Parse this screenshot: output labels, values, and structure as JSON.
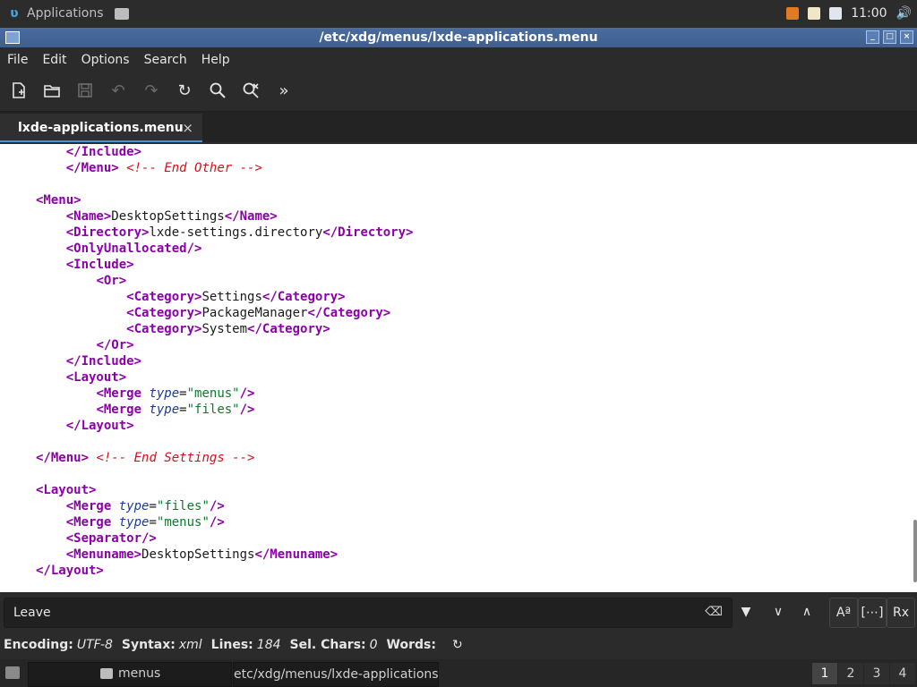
{
  "top_panel": {
    "applications_label": "Applications",
    "clock": "11:00"
  },
  "window": {
    "title": "/etc/xdg/menus/lxde-applications.menu",
    "buttons": {
      "minimize": "_",
      "maximize": "□",
      "close": "×"
    }
  },
  "menubar": {
    "items": [
      "File",
      "Edit",
      "Options",
      "Search",
      "Help"
    ]
  },
  "tabs": [
    {
      "label": "lxde-applications.menu",
      "close": "×"
    }
  ],
  "editor": {
    "lines": [
      [
        {
          "t": "    "
        },
        {
          "c": "tag",
          "t": "</Include>"
        }
      ],
      [
        {
          "t": "    "
        },
        {
          "c": "tag",
          "t": "</Menu>"
        },
        {
          "t": " "
        },
        {
          "c": "com",
          "t": "<!-- End Other -->"
        }
      ],
      [],
      [
        {
          "c": "tag",
          "t": "<Menu>"
        }
      ],
      [
        {
          "t": "    "
        },
        {
          "c": "tag",
          "t": "<Name>"
        },
        {
          "t": "DesktopSettings"
        },
        {
          "c": "tag",
          "t": "</Name>"
        }
      ],
      [
        {
          "t": "    "
        },
        {
          "c": "tag",
          "t": "<Directory>"
        },
        {
          "t": "lxde-settings.directory"
        },
        {
          "c": "tag",
          "t": "</Directory>"
        }
      ],
      [
        {
          "t": "    "
        },
        {
          "c": "tag",
          "t": "<OnlyUnallocated/>"
        }
      ],
      [
        {
          "t": "    "
        },
        {
          "c": "tag",
          "t": "<Include>"
        }
      ],
      [
        {
          "t": "        "
        },
        {
          "c": "tag",
          "t": "<Or>"
        }
      ],
      [
        {
          "t": "            "
        },
        {
          "c": "tag",
          "t": "<Category>"
        },
        {
          "t": "Settings"
        },
        {
          "c": "tag",
          "t": "</Category>"
        }
      ],
      [
        {
          "t": "            "
        },
        {
          "c": "tag",
          "t": "<Category>"
        },
        {
          "t": "PackageManager"
        },
        {
          "c": "tag",
          "t": "</Category>"
        }
      ],
      [
        {
          "t": "            "
        },
        {
          "c": "tag",
          "t": "<Category>"
        },
        {
          "t": "System"
        },
        {
          "c": "tag",
          "t": "</Category>"
        }
      ],
      [
        {
          "t": "        "
        },
        {
          "c": "tag",
          "t": "</Or>"
        }
      ],
      [
        {
          "t": "    "
        },
        {
          "c": "tag",
          "t": "</Include>"
        }
      ],
      [
        {
          "t": "    "
        },
        {
          "c": "tag",
          "t": "<Layout>"
        }
      ],
      [
        {
          "t": "        "
        },
        {
          "c": "tag",
          "t": "<Merge "
        },
        {
          "c": "attr",
          "t": "type"
        },
        {
          "t": "="
        },
        {
          "c": "str",
          "t": "\"menus\""
        },
        {
          "c": "tag",
          "t": "/>"
        }
      ],
      [
        {
          "t": "        "
        },
        {
          "c": "tag",
          "t": "<Merge "
        },
        {
          "c": "attr",
          "t": "type"
        },
        {
          "t": "="
        },
        {
          "c": "str",
          "t": "\"files\""
        },
        {
          "c": "tag",
          "t": "/>"
        }
      ],
      [
        {
          "t": "    "
        },
        {
          "c": "tag",
          "t": "</Layout>"
        }
      ],
      [],
      [
        {
          "c": "tag",
          "t": "</Menu>"
        },
        {
          "t": " "
        },
        {
          "c": "com",
          "t": "<!-- End Settings -->"
        }
      ],
      [],
      [
        {
          "c": "tag",
          "t": "<Layout>"
        }
      ],
      [
        {
          "t": "    "
        },
        {
          "c": "tag",
          "t": "<Merge "
        },
        {
          "c": "attr",
          "t": "type"
        },
        {
          "t": "="
        },
        {
          "c": "str",
          "t": "\"files\""
        },
        {
          "c": "tag",
          "t": "/>"
        }
      ],
      [
        {
          "t": "    "
        },
        {
          "c": "tag",
          "t": "<Merge "
        },
        {
          "c": "attr",
          "t": "type"
        },
        {
          "t": "="
        },
        {
          "c": "str",
          "t": "\"menus\""
        },
        {
          "c": "tag",
          "t": "/>"
        }
      ],
      [
        {
          "t": "    "
        },
        {
          "c": "tag",
          "t": "<Separator/>"
        }
      ],
      [
        {
          "t": "    "
        },
        {
          "c": "tag",
          "t": "<Menuname>"
        },
        {
          "t": "DesktopSettings"
        },
        {
          "c": "tag",
          "t": "</Menuname>"
        }
      ],
      [
        {
          "c": "tag",
          "t": "</Layout>"
        }
      ]
    ]
  },
  "findbar": {
    "value": "Leave",
    "clear_icon": "⌫",
    "dropdown_icon": "▼",
    "prev_icon": "∨",
    "next_icon": "∧",
    "match_case_label": "Aª",
    "whole_word_label": "[⋯]",
    "regex_label": "Rx"
  },
  "statusbar": {
    "encoding_key": "Encoding:",
    "encoding_val": "UTF-8",
    "syntax_key": "Syntax:",
    "syntax_val": "xml",
    "lines_key": "Lines:",
    "lines_val": "184",
    "sel_key": "Sel. Chars:",
    "sel_val": "0",
    "words_key": "Words:",
    "words_val": ""
  },
  "taskbar": {
    "tasks": [
      {
        "label": ""
      },
      {
        "label": "menus"
      },
      {
        "label": "etc/xdg/menus/lxde-applications.m"
      }
    ],
    "desktops": [
      "1",
      "2",
      "3",
      "4"
    ],
    "active_desktop": "1"
  }
}
